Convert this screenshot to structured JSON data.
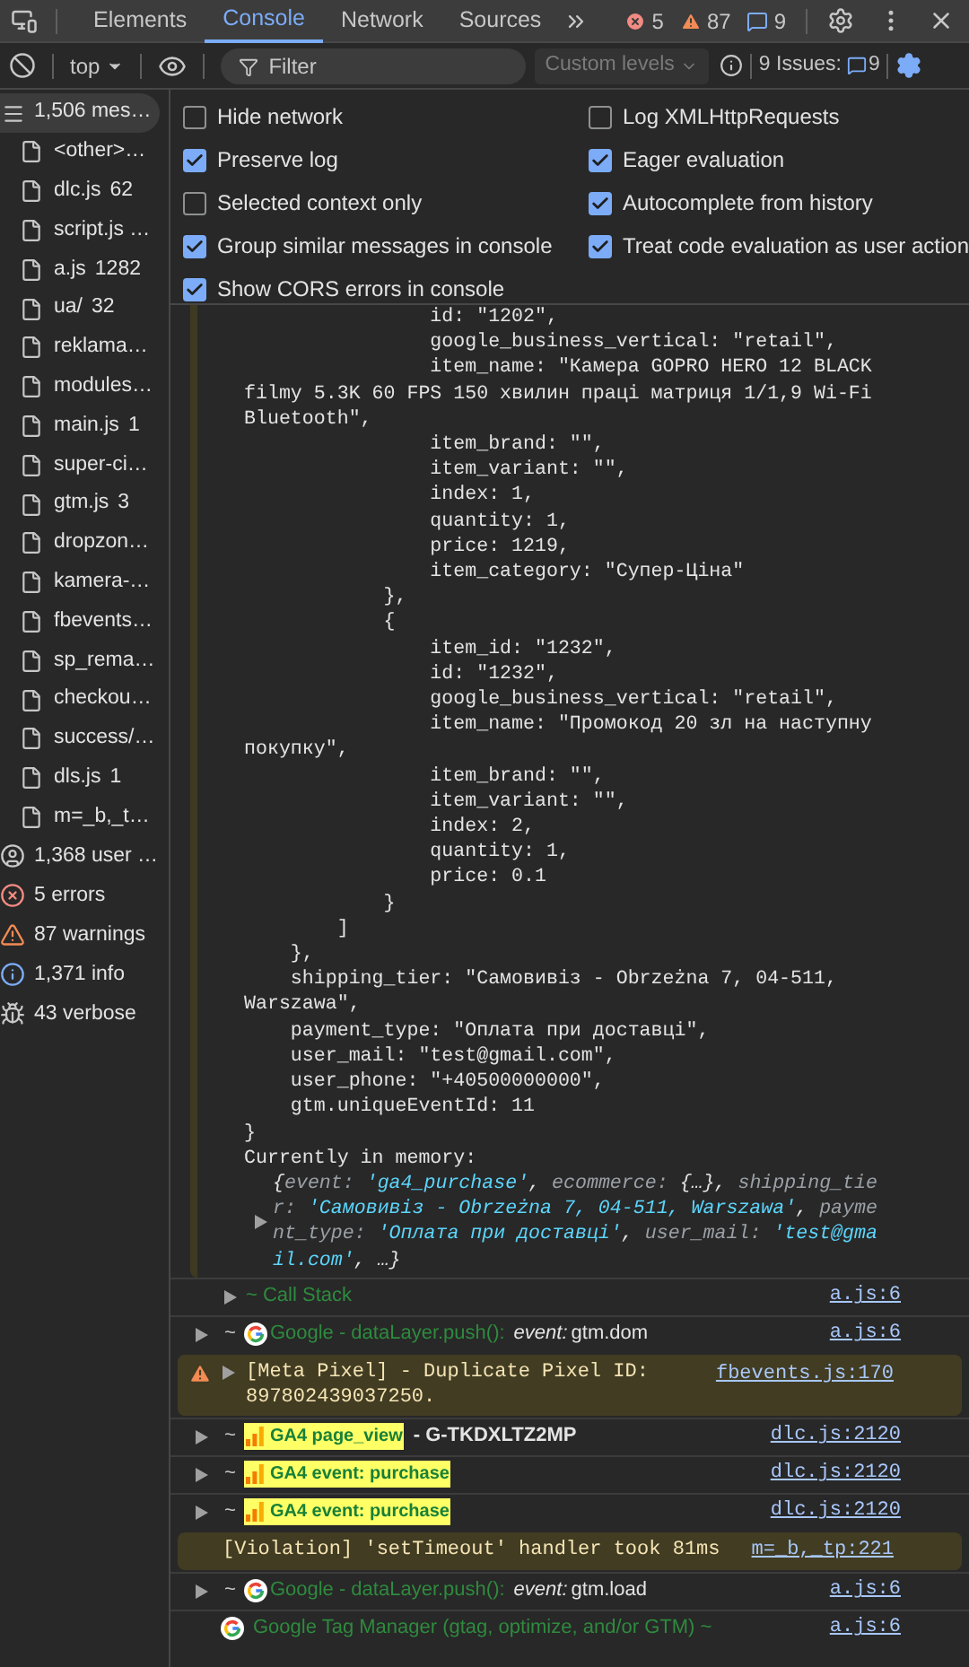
{
  "tabs": [
    {
      "label": "Elements",
      "selected": false
    },
    {
      "label": "Console",
      "selected": true
    },
    {
      "label": "Network",
      "selected": false
    },
    {
      "label": "Sources",
      "selected": false
    }
  ],
  "counts": {
    "errors": "5",
    "warnings": "87",
    "issues": "9"
  },
  "toolbar": {
    "context": "top",
    "filter_placeholder": "Filter",
    "levels": "Custom levels",
    "issues_label": "9 Issues:",
    "issues_count": "9"
  },
  "settings": {
    "left": [
      {
        "label": "Hide network",
        "checked": false
      },
      {
        "label": "Preserve log",
        "checked": true
      },
      {
        "label": "Selected context only",
        "checked": false
      },
      {
        "label": "Group similar messages in console",
        "checked": true
      },
      {
        "label": "Show CORS errors in console",
        "checked": true
      }
    ],
    "right": [
      {
        "label": "Log XMLHttpRequests",
        "checked": false
      },
      {
        "label": "Eager evaluation",
        "checked": true
      },
      {
        "label": "Autocomplete from history",
        "checked": true
      },
      {
        "label": "Treat code evaluation as user action",
        "checked": true
      }
    ]
  },
  "sidebar": {
    "all": {
      "label": "1,506 mes…",
      "selected": true
    },
    "files": [
      {
        "name": "<other>…"
      },
      {
        "name": "dlc.js",
        "count": "62"
      },
      {
        "name": "script.js …"
      },
      {
        "name": "a.js",
        "count": "1282"
      },
      {
        "name": "ua/",
        "count": "32"
      },
      {
        "name": "reklama…"
      },
      {
        "name": "modules…"
      },
      {
        "name": "main.js",
        "count": "1"
      },
      {
        "name": "super-ci…"
      },
      {
        "name": "gtm.js",
        "count": "3"
      },
      {
        "name": "dropzon…"
      },
      {
        "name": "kamera-…"
      },
      {
        "name": "fbevents…"
      },
      {
        "name": "sp_rema…"
      },
      {
        "name": "checkou…"
      },
      {
        "name": "success/…"
      },
      {
        "name": "dls.js",
        "count": "1"
      },
      {
        "name": "m=_b,_t…"
      }
    ],
    "levels": [
      {
        "kind": "user",
        "label": "1,368 user …"
      },
      {
        "kind": "error",
        "label": "5 errors"
      },
      {
        "kind": "warning",
        "label": "87 warnings"
      },
      {
        "kind": "info",
        "label": "1,371 info"
      },
      {
        "kind": "verbose",
        "label": "43 verbose"
      }
    ]
  },
  "code_lines": [
    "                id: \"1202\",",
    "                google_business_vertical: \"retail\",",
    "                item_name: \"Камера GOPRO HERO 12 BLACK",
    "filmy 5.3K 60 FPS 150 хвилин праці матриця 1/1,9 Wi-Fi",
    "Bluetooth\",",
    "                item_brand: \"\",",
    "                item_variant: \"\",",
    "                index: 1,",
    "                quantity: 1,",
    "                price: 1219,",
    "                item_category: \"Супер-Ціна\"",
    "            },",
    "            {",
    "                item_id: \"1232\",",
    "                id: \"1232\",",
    "                google_business_vertical: \"retail\",",
    "                item_name: \"Промокод 20 зл на наступну",
    "покупку\",",
    "                item_brand: \"\",",
    "                item_variant: \"\",",
    "                index: 2,",
    "                quantity: 1,",
    "                price: 0.1",
    "            }",
    "        ]",
    "    },",
    "    shipping_tier: \"Самовивіз - Obrzeżna 7, 04-511,",
    "Warszawa\",",
    "    payment_type: \"Оплата при доставці\",",
    "    user_mail: \"test@gmail.com\",",
    "    user_phone: \"+40500000000\",",
    "    gtm.uniqueEventId: 11",
    "}"
  ],
  "memory_label": "Currently in memory:",
  "memory_preview": [
    {
      "kind": "punct",
      "text": "{"
    },
    {
      "kind": "key",
      "text": "event: "
    },
    {
      "kind": "value",
      "text": "'ga4_purchase'"
    },
    {
      "kind": "punct",
      "text": ", "
    },
    {
      "kind": "key",
      "text": "ecommerce: "
    },
    {
      "kind": "punct",
      "text": "{…}, "
    },
    {
      "kind": "key",
      "text": "shipping_tier: "
    },
    {
      "kind": "value",
      "text": "'Самовивіз - Obrzeżna 7, 04-511, Warszawa'"
    },
    {
      "kind": "punct",
      "text": ", "
    },
    {
      "kind": "key",
      "text": "payment_type: "
    },
    {
      "kind": "value",
      "text": "'Оплата при доставці'"
    },
    {
      "kind": "punct",
      "text": ", "
    },
    {
      "kind": "key",
      "text": "user_mail: "
    },
    {
      "kind": "value",
      "text": "'test@gmail.com'"
    },
    {
      "kind": "punct",
      "text": ", …}"
    }
  ],
  "messages": [
    {
      "kind": "group",
      "text": "~ Call Stack",
      "source": "a.js:6"
    },
    {
      "kind": "google",
      "prefix": "~",
      "label": "Google - dataLayer.push():",
      "event_label": "event:",
      "event_value": "gtm.dom",
      "source": "a.js:6"
    },
    {
      "kind": "warning",
      "text": "[Meta Pixel] - Duplicate Pixel ID: 897802439037250.",
      "source": "fbevents.js:170"
    },
    {
      "kind": "ga4",
      "prefix": "~",
      "label": "GA4 page_view",
      "suffix": "- G-TKDXLTZ2MP",
      "source": "dlc.js:2120"
    },
    {
      "kind": "ga4",
      "prefix": "~",
      "label": "GA4 event: purchase",
      "source": "dlc.js:2120"
    },
    {
      "kind": "ga4",
      "prefix": "~",
      "label": "GA4 event: purchase",
      "source": "dlc.js:2120"
    },
    {
      "kind": "violation",
      "text": "[Violation] 'setTimeout' handler took 81ms",
      "source": "m=_b,_tp:221"
    },
    {
      "kind": "google",
      "prefix": "~",
      "label": "Google - dataLayer.push():",
      "event_label": "event:",
      "event_value": "gtm.load",
      "source": "a.js:6"
    },
    {
      "kind": "gtm",
      "text": "Google Tag Manager (gtag, optimize, and/or GTM) ~",
      "source": "a.js:6"
    }
  ]
}
